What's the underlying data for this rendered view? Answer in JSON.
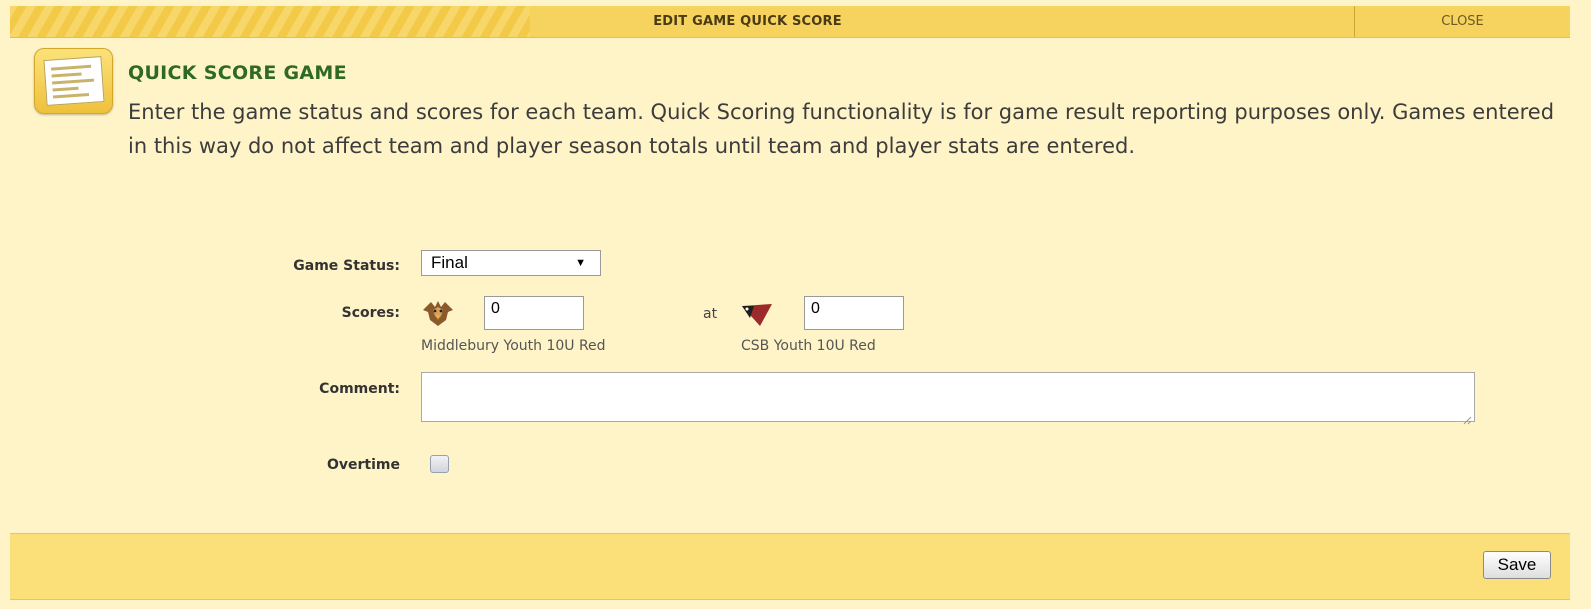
{
  "dialog": {
    "title": "EDIT GAME QUICK SCORE",
    "close_label": "CLOSE"
  },
  "header": {
    "heading": "QUICK SCORE GAME",
    "description": "Enter the game status and scores for each team. Quick Scoring functionality is for game result reporting purposes only. Games entered in this way do not affect team and player season totals until team and player stats are entered."
  },
  "form": {
    "game_status_label": "Game Status:",
    "game_status_value": "Final",
    "scores_label": "Scores:",
    "away_team": {
      "name": "Middlebury Youth 10U Red",
      "score": "0",
      "logo_icon": "hawk-logo-icon"
    },
    "at_label": "at",
    "home_team": {
      "name": "CSB Youth 10U Red",
      "score": "0",
      "logo_icon": "bird-logo-icon"
    },
    "comment_label": "Comment:",
    "comment_value": "",
    "overtime_label": "Overtime",
    "overtime_checked": false
  },
  "footer": {
    "save_label": "Save"
  },
  "colors": {
    "panel_bg": "#fff4c7",
    "titlebar": "#f6d25f",
    "footer_bg": "#fbdf79",
    "heading_green": "#2f6a22"
  }
}
